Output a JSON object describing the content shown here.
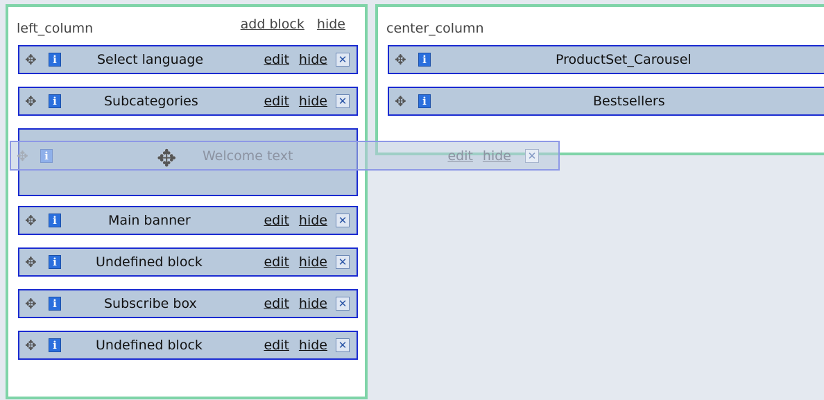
{
  "left_column": {
    "title": "left_column",
    "add_block": "add block",
    "hide": "hide",
    "blocks": [
      {
        "title": "Select language",
        "edit": "edit",
        "hide": "hide"
      },
      {
        "title": "Subcategories",
        "edit": "edit",
        "hide": "hide"
      },
      {
        "title": "Main banner",
        "edit": "edit",
        "hide": "hide"
      },
      {
        "title": "Undefined block",
        "edit": "edit",
        "hide": "hide"
      },
      {
        "title": "Subscribe box",
        "edit": "edit",
        "hide": "hide"
      },
      {
        "title": "Undefined block",
        "edit": "edit",
        "hide": "hide"
      }
    ]
  },
  "center_column": {
    "title": "center_column",
    "blocks": [
      {
        "title": "ProductSet_Carousel"
      },
      {
        "title": "Bestsellers"
      }
    ]
  },
  "dragged_block": {
    "title": "Welcome text",
    "edit": "edit",
    "hide": "hide"
  },
  "icons": {
    "move": "move-handle-icon",
    "info": "info-icon",
    "remove": "remove-icon",
    "cursor": "move-cursor-icon"
  },
  "colors": {
    "column_border": "#7fd4a8",
    "block_fill": "#b8c9dc",
    "block_border": "#1a2bd1",
    "info_icon": "#2a6fdd",
    "background": "#e4e9f0"
  }
}
